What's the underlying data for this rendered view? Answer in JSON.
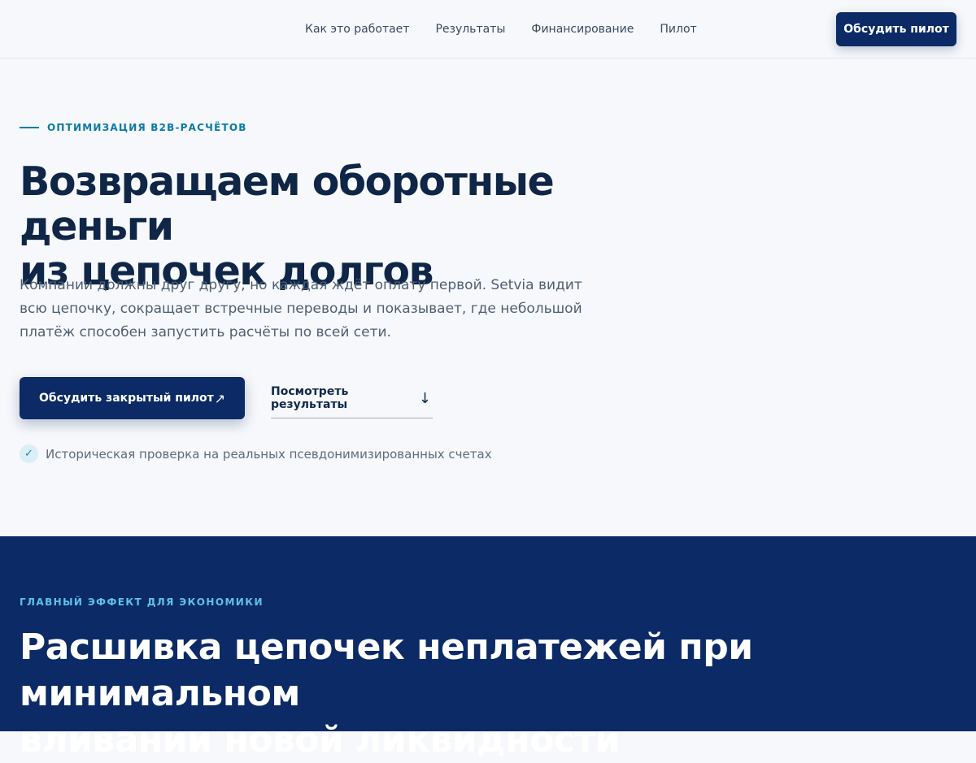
{
  "nav": {
    "items": [
      {
        "label": "Как это работает"
      },
      {
        "label": "Результаты"
      },
      {
        "label": "Финансирование"
      },
      {
        "label": "Пилот"
      }
    ],
    "cta_label": "Обсудить пилот"
  },
  "hero": {
    "eyebrow": "ОПТИМИЗАЦИЯ B2B-РАСЧЁТОВ",
    "title_line1": "Возвращаем оборотные деньги",
    "title_line2": "из цепочек долгов",
    "lead": "Компании должны друг другу, но каждая ждёт оплату первой. Setvia видит всю цепочку, сокращает встречные переводы и показывает, где небольшой платёж способен запустить расчёты по всей сети.",
    "primary_button": {
      "label": "Обсудить закрытый пилот",
      "arrow": "↗"
    },
    "secondary_link": {
      "label": "Посмотреть результаты",
      "arrow": "↓"
    },
    "verify": {
      "icon": "check-icon",
      "text": "Историческая проверка на реальных псевдонимизированных счетах"
    }
  },
  "effect": {
    "eyebrow": "ГЛАВНЫЙ ЭФФЕКТ ДЛЯ ЭКОНОМИКИ",
    "title_line1": "Расшивка цепочек неплатежей при минимальном",
    "title_line2": "вливании новой ликвидности"
  },
  "colors": {
    "brand_navy": "#0b2a66",
    "accent_teal": "#0a7aa6",
    "accent_light_blue": "#5fc2ea",
    "background": "#f6f8fb"
  }
}
